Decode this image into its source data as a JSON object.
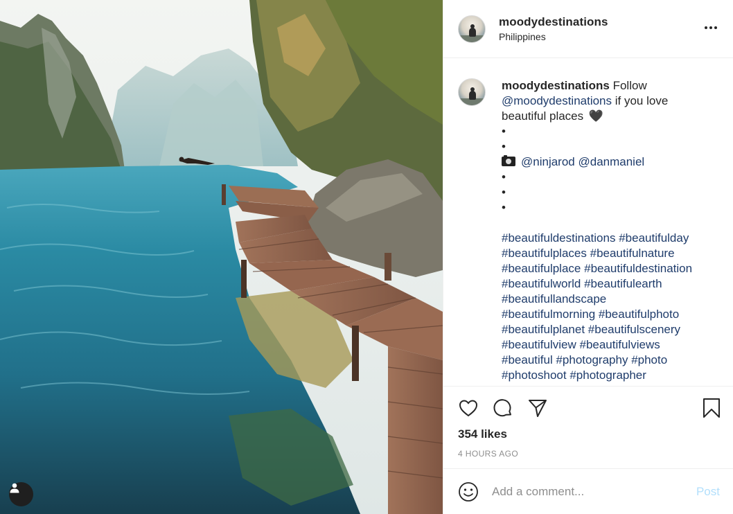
{
  "post": {
    "username": "moodydestinations",
    "location": "Philippines",
    "more_icon": "more-horizontal-icon",
    "caption": {
      "username": "moodydestinations",
      "text_1": "Follow",
      "mention_main": "@moodydestinations",
      "text_2": "if you love",
      "text_3": "beautiful places",
      "heart_emoji": "🖤",
      "dots_top": [
        "•",
        "•"
      ],
      "camera_emoji": "📷",
      "credits": [
        "@ninjarod",
        "@danmaniel"
      ],
      "dots_bottom": [
        "•",
        "•",
        "•"
      ],
      "hashtag_lines": [
        [
          "#beautifuldestinations",
          "#beautifulday"
        ],
        [
          "#beautifulplaces",
          "#beautifulnature"
        ],
        [
          "#beautifulplace",
          "#beautifuldestination"
        ],
        [
          "#beautifulworld",
          "#beautifulearth"
        ],
        [
          "#beautifullandscape"
        ],
        [
          "#beautifulmorning",
          "#beautifulphoto"
        ],
        [
          "#beautifulplanet",
          "#beautifulscenery"
        ],
        [
          "#beautifulview",
          "#beautifulviews"
        ],
        [
          "#beautiful",
          "#photography",
          "#photo"
        ],
        [
          "#photoshoot",
          "#photographer"
        ]
      ]
    },
    "likes": "354 likes",
    "time": "4 HOURS AGO",
    "comment_placeholder": "Add a comment...",
    "post_label": "Post"
  },
  "icons": {
    "like": "heart-outline-icon",
    "comment": "comment-bubble-icon",
    "share": "paper-plane-icon",
    "save": "bookmark-icon",
    "emoji": "smiley-face-icon",
    "user_tag": "user-tag-icon"
  },
  "colors": {
    "link": "#1f3c6b",
    "muted": "#8e8e8e",
    "post_disabled": "#b2dffc",
    "text": "#262626"
  }
}
